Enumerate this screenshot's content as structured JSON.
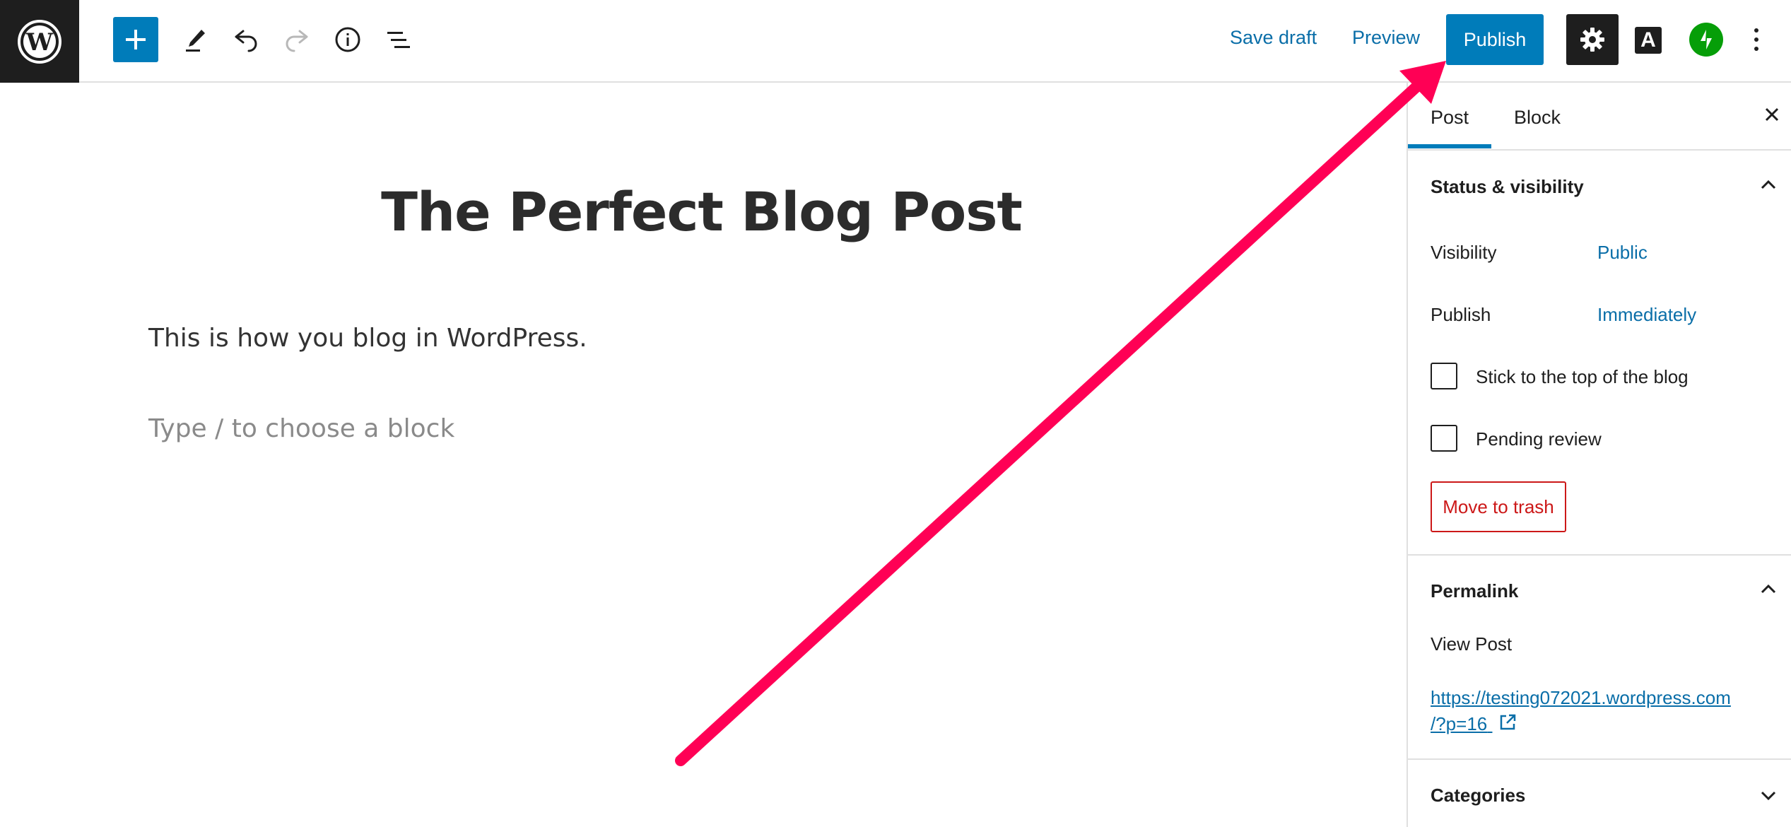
{
  "toolbar": {
    "save_draft": "Save draft",
    "preview": "Preview",
    "publish": "Publish",
    "font_button": "A",
    "icons": [
      "wordpress-logo-icon",
      "plus-icon",
      "pencil-icon",
      "undo-icon",
      "redo-icon",
      "info-icon",
      "list-view-icon",
      "gear-icon",
      "jetpack-icon",
      "more-vertical-icon"
    ]
  },
  "editor": {
    "title": "The Perfect Blog Post",
    "paragraph": "This is how you blog in WordPress.",
    "placeholder": "Type / to choose a block"
  },
  "sidebar": {
    "tabs": [
      "Post",
      "Block"
    ],
    "status": {
      "title": "Status & visibility",
      "visibility_label": "Visibility",
      "visibility_value": "Public",
      "publish_label": "Publish",
      "publish_value": "Immediately",
      "stick_label": "Stick to the top of the blog",
      "pending_label": "Pending review",
      "trash_label": "Move to trash"
    },
    "permalink": {
      "title": "Permalink",
      "view_post": "View Post",
      "url_line1": "https://testing072021.wordpress.com",
      "url_line2": "/?p=16"
    },
    "categories": {
      "title": "Categories"
    }
  },
  "colors": {
    "accent": "#007cba",
    "link": "#0a6ea8",
    "danger": "#cc1818",
    "annotation_arrow": "#ff0055",
    "jetpack": "#069e08"
  }
}
